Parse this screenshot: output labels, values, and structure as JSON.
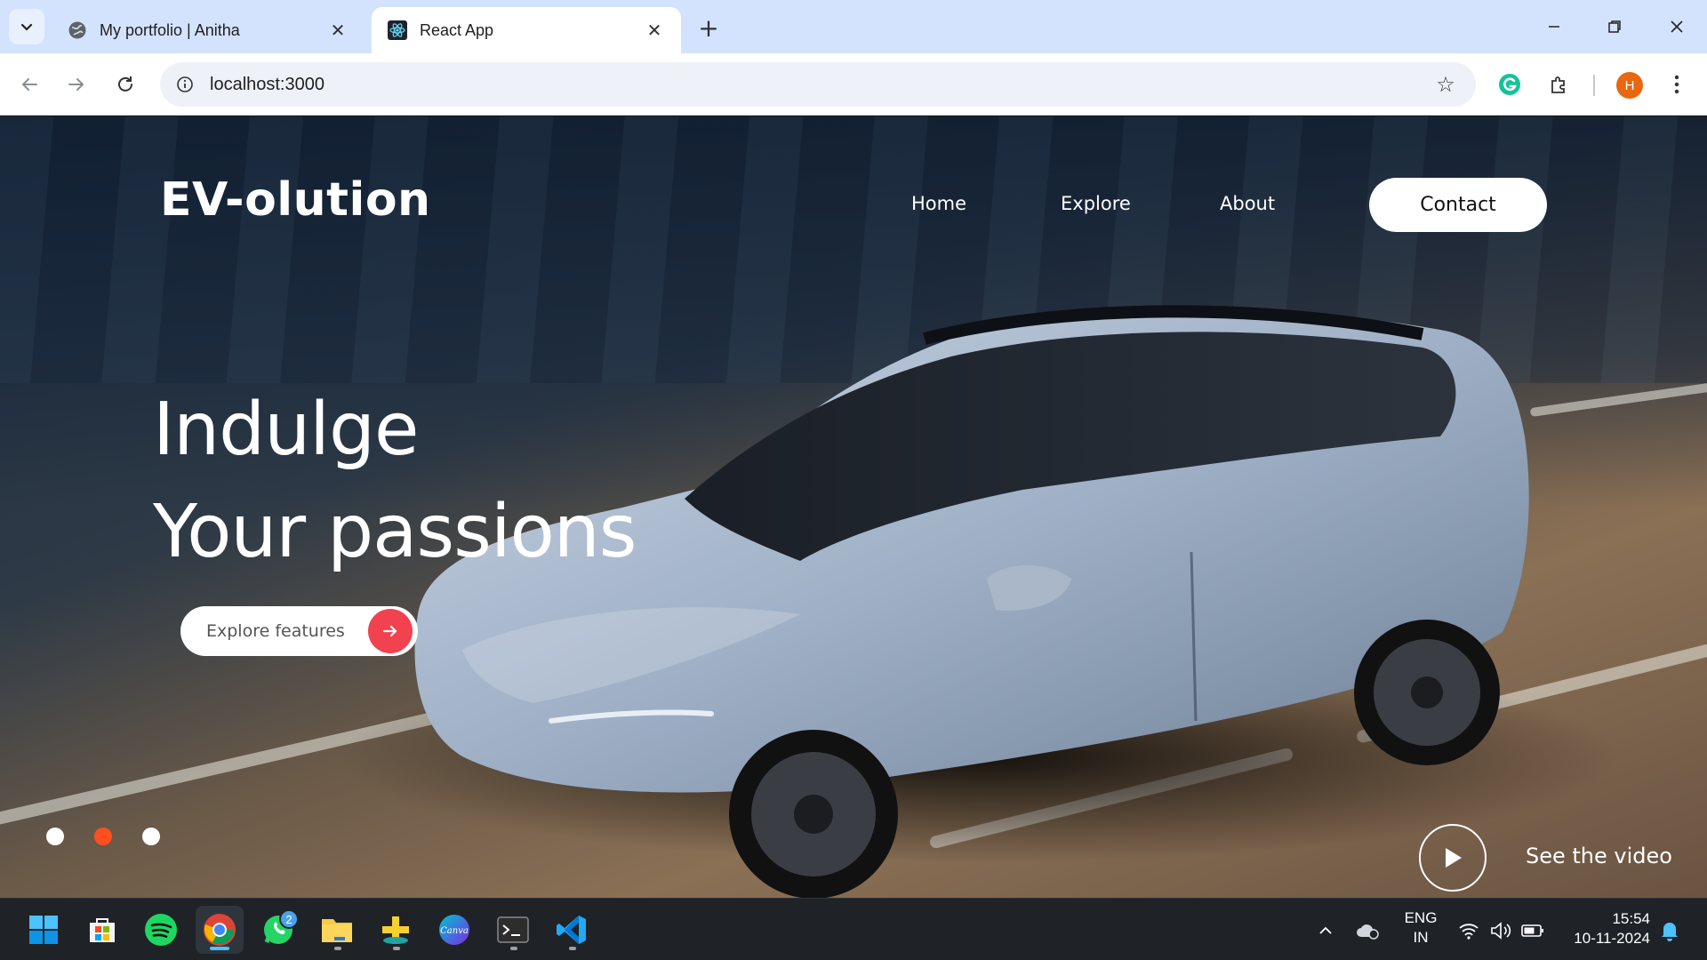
{
  "browser": {
    "tabs": [
      {
        "title": "My portfolio | Anitha",
        "favicon": "globe-icon",
        "active": false
      },
      {
        "title": "React App",
        "favicon": "react-icon",
        "active": true
      }
    ],
    "url": "localhost:3000",
    "profile_initial": "H",
    "accent": "#e9670e"
  },
  "site": {
    "brand": "EV-olution",
    "nav": [
      "Home",
      "Explore",
      "About"
    ],
    "contact_label": "Contact",
    "hero": {
      "line1": "Indulge",
      "line2": "Your passions"
    },
    "explore_button": "Explore features",
    "carousel": {
      "dots": 3,
      "active_index": 1,
      "active_color": "#ff4f1f"
    },
    "video_label": "See the video",
    "cta_color": "#f2414f"
  },
  "taskbar": {
    "apps": [
      "windows-start",
      "microsoft-store",
      "spotify",
      "chrome",
      "whatsapp",
      "file-explorer",
      "app-plus",
      "canva",
      "terminal",
      "vscode"
    ],
    "whatsapp_badge": "2",
    "lang_line1": "ENG",
    "lang_line2": "IN",
    "time": "15:54",
    "date": "10-11-2024"
  }
}
